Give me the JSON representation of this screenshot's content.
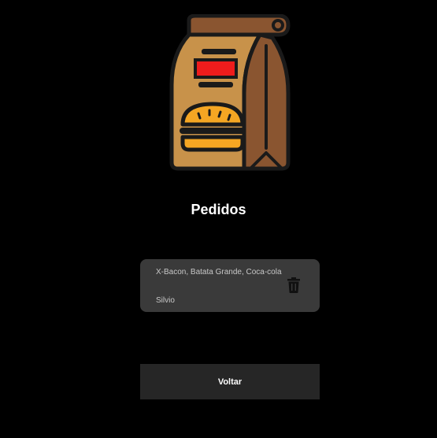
{
  "header": {
    "logo_icon": "food-bag-burger-icon",
    "title": "Pedidos"
  },
  "orders": [
    {
      "items": "X-Bacon, Batata Grande, Coca-cola",
      "customer": "Silvio",
      "delete_icon": "trash-icon"
    }
  ],
  "actions": {
    "back_label": "Voltar"
  },
  "colors": {
    "background": "#000000",
    "card": "#3a3a3a",
    "button": "#262626",
    "bag": "#c8924a",
    "bag_dark": "#8a5530",
    "label_red": "#ee1c1c",
    "bun": "#f5a623"
  }
}
